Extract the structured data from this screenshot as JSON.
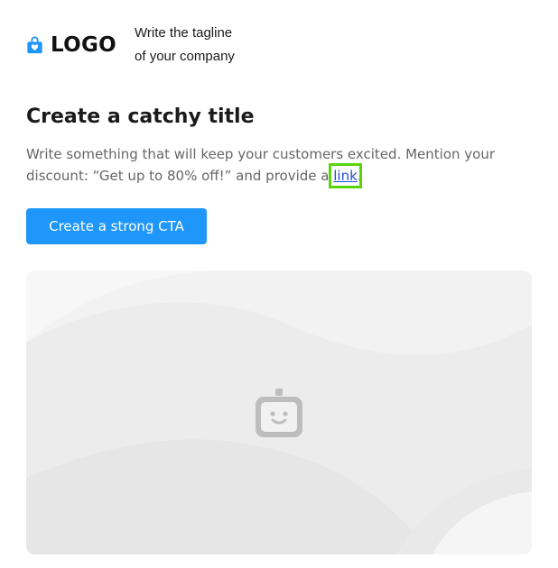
{
  "header": {
    "logo_text": "LOGO",
    "logo_icon": "shopping-bag-icon",
    "tagline_line1": "Write the tagline",
    "tagline_line2": "of your company"
  },
  "main": {
    "title": "Create a catchy title",
    "body_before_link": "Write something that will keep your customers excited. Mention your discount: “Get up to 80% off!” and provide a ",
    "link_text": "link",
    "body_after_link": ".",
    "cta_label": "Create a strong CTA",
    "image_placeholder_icon": "image-placeholder-robot-icon"
  },
  "colors": {
    "accent": "#1e96fa",
    "link": "#1f4fd9",
    "highlight": "#5ad40b",
    "placeholder_bg": "#f1f1f1",
    "placeholder_icon": "#bdbdbd"
  }
}
